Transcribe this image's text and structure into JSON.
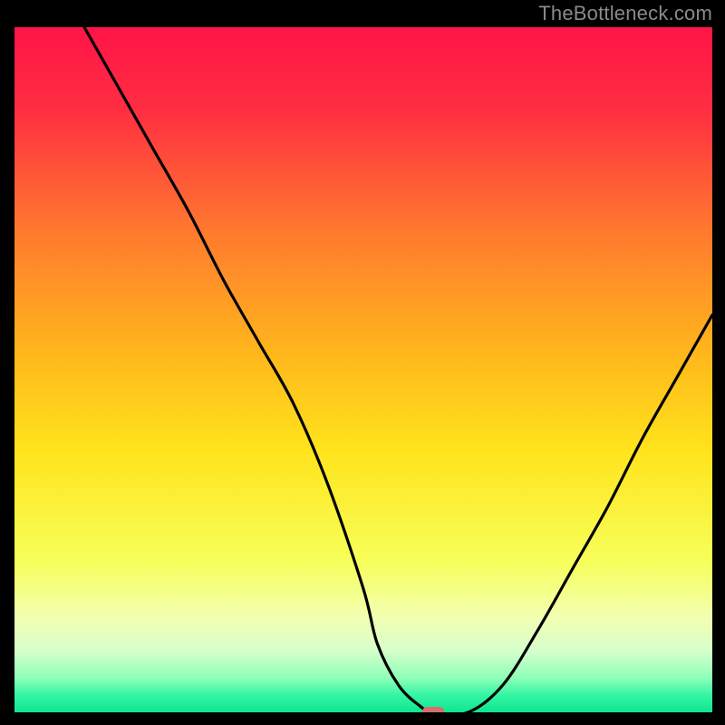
{
  "attribution": "TheBottleneck.com",
  "chart_data": {
    "type": "line",
    "title": "",
    "xlabel": "",
    "ylabel": "",
    "xlim": [
      0,
      100
    ],
    "ylim": [
      0,
      100
    ],
    "grid": false,
    "legend": false,
    "series": [
      {
        "name": "bottleneck-curve",
        "x": [
          10,
          15,
          20,
          25,
          30,
          35,
          40,
          45,
          50,
          52,
          55,
          58,
          60,
          65,
          70,
          75,
          80,
          85,
          90,
          95,
          100
        ],
        "values": [
          100,
          91,
          82,
          73,
          63,
          54,
          45,
          33,
          18,
          10,
          4,
          1,
          0,
          0,
          4,
          12,
          21,
          30,
          40,
          49,
          58
        ]
      }
    ],
    "marker": {
      "x": 60,
      "y": 0,
      "color": "#d96d6d"
    },
    "background_gradient_stops": [
      {
        "offset": 0.0,
        "color": "#ff1447"
      },
      {
        "offset": 0.12,
        "color": "#ff2e42"
      },
      {
        "offset": 0.3,
        "color": "#ff7a2e"
      },
      {
        "offset": 0.48,
        "color": "#ffb81c"
      },
      {
        "offset": 0.62,
        "color": "#ffe41c"
      },
      {
        "offset": 0.78,
        "color": "#f7ff5a"
      },
      {
        "offset": 0.86,
        "color": "#f2ffb0"
      },
      {
        "offset": 0.91,
        "color": "#d7ffcc"
      },
      {
        "offset": 0.95,
        "color": "#8effb8"
      },
      {
        "offset": 0.975,
        "color": "#34f5a5"
      },
      {
        "offset": 1.0,
        "color": "#0fe68f"
      }
    ]
  }
}
